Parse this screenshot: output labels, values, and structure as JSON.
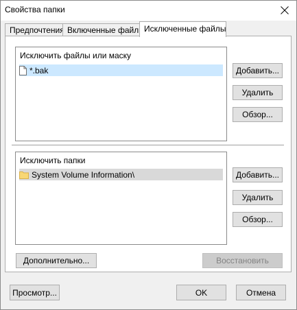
{
  "window": {
    "title": "Свойства папки"
  },
  "tabs": [
    {
      "label": "Предпочтения"
    },
    {
      "label": "Включенные файлы"
    },
    {
      "label": "Исключенные файлы"
    }
  ],
  "exclude_files": {
    "group_label": "Исключить файлы или маску",
    "items": [
      {
        "text": "*.bak",
        "icon": "file-icon"
      }
    ],
    "buttons": {
      "add": "Добавить...",
      "remove": "Удалить",
      "browse": "Обзор..."
    }
  },
  "exclude_folders": {
    "group_label": "Исключить папки",
    "items": [
      {
        "text": "System Volume Information\\",
        "icon": "folder-icon"
      }
    ],
    "buttons": {
      "add": "Добавить...",
      "remove": "Удалить",
      "browse": "Обзор..."
    }
  },
  "panel_buttons": {
    "advanced": "Дополнительно...",
    "restore": "Восстановить"
  },
  "footer_buttons": {
    "preview": "Просмотр...",
    "ok": "OK",
    "cancel": "Отмена"
  },
  "colors": {
    "selection": "#cce8ff",
    "selection_inactive": "#d9d9d9",
    "folder": "#f8d775"
  }
}
